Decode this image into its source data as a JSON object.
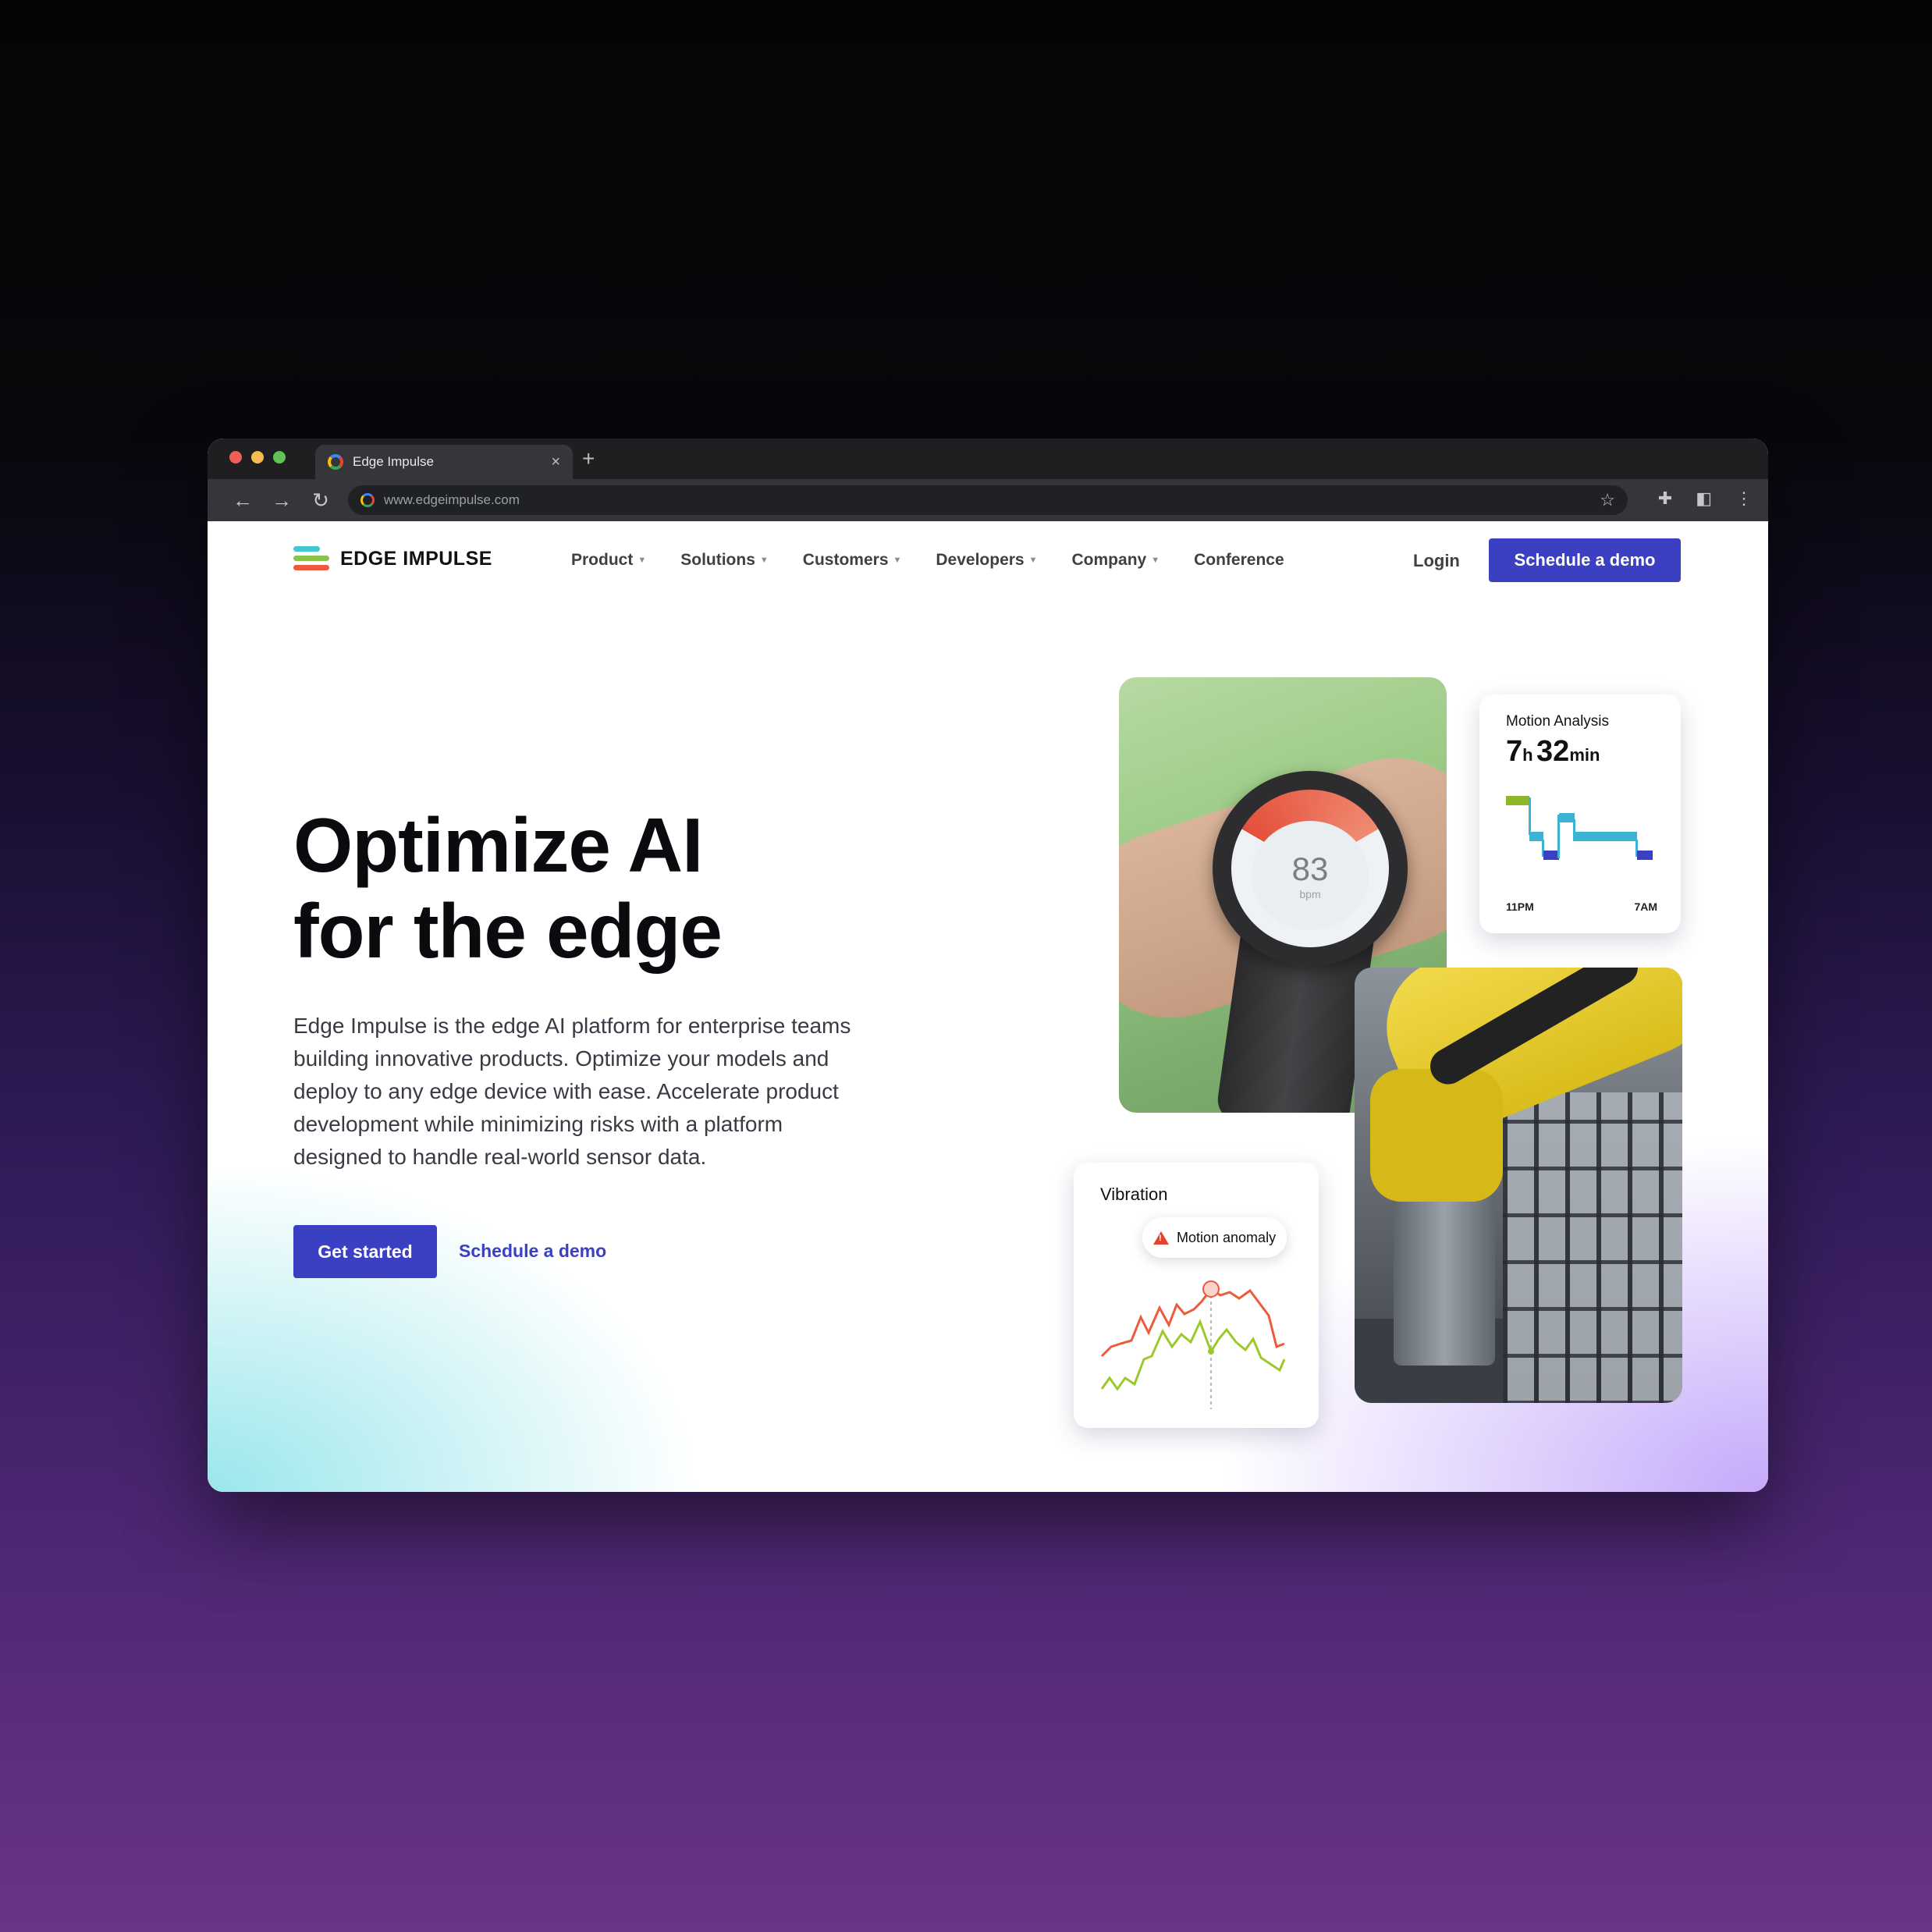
{
  "browser": {
    "tab_title": "Edge Impulse",
    "tab_close": "×",
    "new_tab": "+",
    "url": "www.edgeimpulse.com"
  },
  "nav": {
    "logo_text": "EDGE IMPULSE",
    "menu": [
      {
        "label": "Product",
        "dropdown": true
      },
      {
        "label": "Solutions",
        "dropdown": true
      },
      {
        "label": "Customers",
        "dropdown": true
      },
      {
        "label": "Developers",
        "dropdown": true
      },
      {
        "label": "Company",
        "dropdown": true
      },
      {
        "label": "Conference",
        "dropdown": false
      }
    ],
    "login": "Login",
    "cta": "Schedule a demo"
  },
  "hero": {
    "title_line1": "Optimize AI",
    "title_line2": "for the edge",
    "description": "Edge Impulse is the edge AI platform for enterprise teams building innovative products. Optimize your models and deploy to any edge device with ease. Accelerate product development while minimizing risks with a platform designed to handle real-world sensor data.",
    "primary_button": "Get started",
    "secondary_link": "Schedule a demo"
  },
  "watch": {
    "bpm_value": "83",
    "bpm_unit": "bpm"
  },
  "motion_card": {
    "label": "Motion Analysis",
    "hours": "7",
    "hours_unit": "h",
    "minutes": "32",
    "minutes_unit": "min",
    "start_tick": "11PM",
    "end_tick": "7AM"
  },
  "vibration_card": {
    "label": "Vibration",
    "alert": "Motion anomaly"
  },
  "colors": {
    "brand_primary": "#3b3fc2",
    "anomaly_line": "#ef5a3c",
    "baseline_line": "#9cc92a",
    "motion_light": "#8fb52a",
    "motion_cyan": "#3bb3d2",
    "motion_dark": "#3b3fc2"
  }
}
